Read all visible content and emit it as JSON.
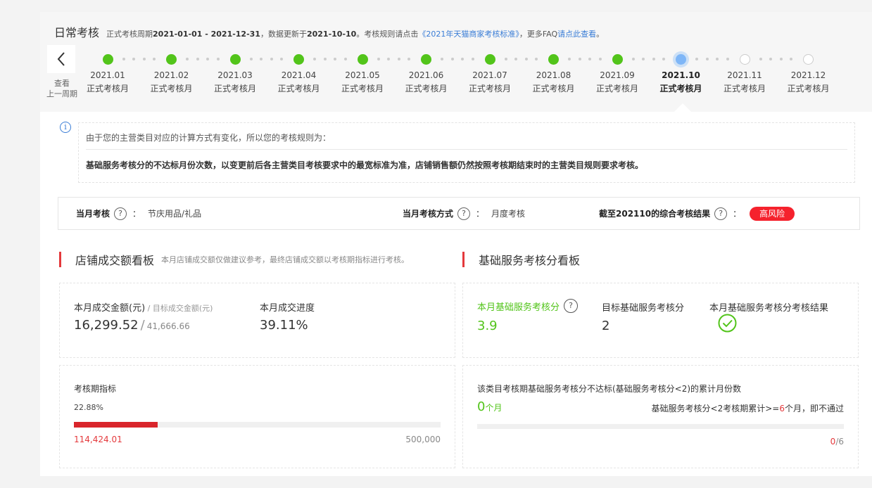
{
  "header": {
    "title": "日常考核",
    "period_label": "正式考核周期",
    "period": "2021-01-01 - 2021-12-31",
    "update_text": "，数据更新于",
    "update_date": "2021-10-10",
    "rules_text": "。考核规则请点击",
    "rules_link": "《2021年天猫商家考核标准》",
    "faq_text": "，更多FAQ",
    "faq_link": "请点此查看",
    "end": "。"
  },
  "timeline": {
    "prev_line1": "查看",
    "prev_line2": "上一周期",
    "months": [
      {
        "date": "2021.01",
        "label": "正式考核月",
        "state": "done"
      },
      {
        "date": "2021.02",
        "label": "正式考核月",
        "state": "done"
      },
      {
        "date": "2021.03",
        "label": "正式考核月",
        "state": "done"
      },
      {
        "date": "2021.04",
        "label": "正式考核月",
        "state": "done"
      },
      {
        "date": "2021.05",
        "label": "正式考核月",
        "state": "done"
      },
      {
        "date": "2021.06",
        "label": "正式考核月",
        "state": "done"
      },
      {
        "date": "2021.07",
        "label": "正式考核月",
        "state": "done"
      },
      {
        "date": "2021.08",
        "label": "正式考核月",
        "state": "done"
      },
      {
        "date": "2021.09",
        "label": "正式考核月",
        "state": "done"
      },
      {
        "date": "2021.10",
        "label": "正式考核月",
        "state": "current"
      },
      {
        "date": "2021.11",
        "label": "正式考核月",
        "state": "future"
      },
      {
        "date": "2021.12",
        "label": "正式考核月",
        "state": "future"
      }
    ]
  },
  "notice": {
    "line1": "由于您的主营类目对应的计算方式有变化，所以您的考核规则为：",
    "line2": "基础服务考核分的不达标月份次数，以变更前后各主营类目考核要求中的最宽标准为准，店铺销售额仍然按照考核期结束时的主营类目规则要求考核。"
  },
  "status": {
    "month_label": "当月考核",
    "month_value": "节庆用品/礼品",
    "method_label": "当月考核方式",
    "method_value": "月度考核",
    "result_label": "截至202110的综合考核结果",
    "result_value": "高风险",
    "q": "?",
    "colon": "："
  },
  "sales": {
    "section_title": "店铺成交额看板",
    "section_note": "本月店铺成交额仅做建议参考，最终店铺成交额以考核期指标进行考核。",
    "amount_label": "本月成交金额(元)",
    "amount_sep": " / ",
    "target_label": "目标成交金额(元)",
    "amount": "16,299.52",
    "target": "41,666.66",
    "progress_label": "本月成交进度",
    "progress": "39.11%",
    "period_label": "考核期指标",
    "period_percent": "22.88%",
    "period_progress": 0.2288,
    "period_value": "114,424.01",
    "period_target": "500,000"
  },
  "service": {
    "section_title": "基础服务考核分看板",
    "score_label": "本月基础服务考核分",
    "score": "3.9",
    "target_label": "目标基础服务考核分",
    "target": "2",
    "result_label": "本月基础服务考核分考核结果",
    "fail_title": "该类目考核期基础服务考核分不达标(基础服务考核分<2)的累计月份数",
    "fail_count": "0",
    "fail_unit": "个月",
    "rule_prefix": "基础服务考核分<2考核期累计>=",
    "rule_num": "6",
    "rule_suffix": "个月，即不通过",
    "count_now": "0",
    "count_total": "/6",
    "count_progress": 0
  },
  "colors": {
    "accent_red": "#e4393c",
    "green": "#52c41a",
    "link": "#3a7dd6",
    "badge_red": "#f5222d"
  }
}
